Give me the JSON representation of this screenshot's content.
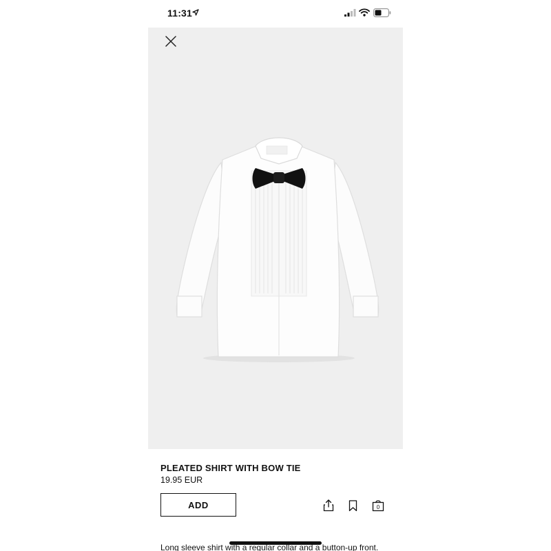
{
  "status_bar": {
    "time": "11:31",
    "icons": [
      "location-arrow-icon",
      "signal-icon",
      "wifi-icon",
      "battery-icon"
    ]
  },
  "product": {
    "image_icon": "shirt-with-bow-tie",
    "title": "PLEATED SHIRT WITH BOW TIE",
    "price": "19.95 EUR",
    "add_label": "ADD",
    "description": "Long sleeve shirt with a regular collar and a button-up front."
  },
  "actions": {
    "icons": [
      "close-icon",
      "share-icon",
      "bookmark-icon",
      "bag-icon"
    ]
  },
  "colors": {
    "hero_background": "#efefef",
    "text": "#111111",
    "page_background": "#ffffff"
  }
}
